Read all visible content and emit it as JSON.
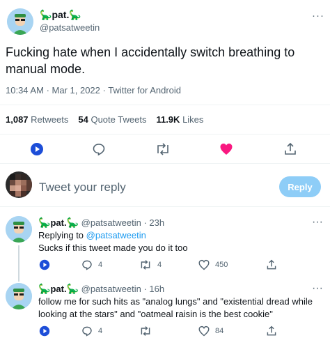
{
  "tweet": {
    "display_name": "pat.",
    "dino_icon": "🦕",
    "handle": "@patsatweetin",
    "text": "Fucking hate when I accidentally switch breathing to manual mode.",
    "time": "10:34 AM",
    "date": "Mar 1, 2022",
    "client": "Twitter for Android",
    "retweets_count": "1,087",
    "retweets_label": "Retweets",
    "quotes_count": "54",
    "quotes_label": "Quote Tweets",
    "likes_count": "11.9K",
    "likes_label": "Likes",
    "more": "···",
    "liked": true,
    "colors": {
      "like": "#f91880",
      "accent": "#1d9bf0",
      "play": "#1d4ed8"
    }
  },
  "composer": {
    "placeholder": "Tweet your reply",
    "button_label": "Reply"
  },
  "replies": [
    {
      "display_name": "pat.",
      "handle": "@patsatweetin",
      "age": "23h",
      "replying_to_prefix": "Replying to",
      "replying_to_handle": "@patsatweetin",
      "text": "Sucks if this tweet made you do it too",
      "replies": "4",
      "retweets": "4",
      "likes": "450"
    },
    {
      "display_name": "pat.",
      "handle": "@patsatweetin",
      "age": "16h",
      "text_line1": "follow me for such hits as \"analog lungs\" and \"existential dread while",
      "text_line2": "looking at the stars\" and \"oatmeal raisin is the best cookie\"",
      "replies": "4",
      "likes": "84"
    }
  ]
}
